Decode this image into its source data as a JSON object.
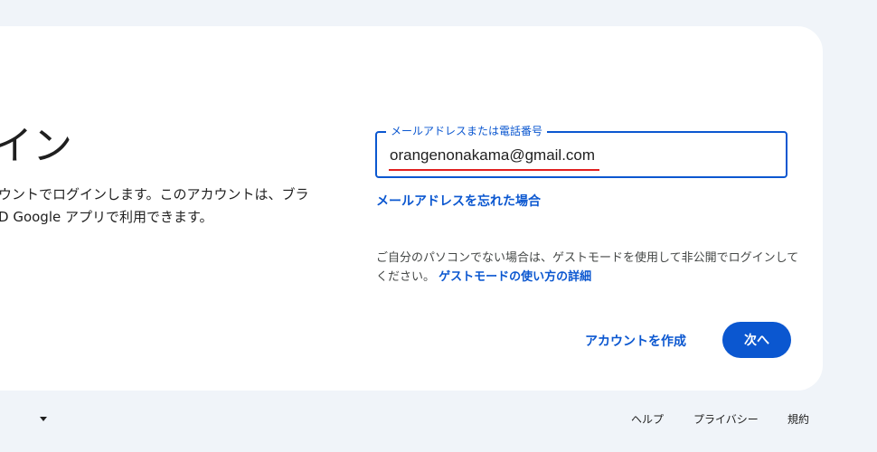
{
  "heading": {
    "title": "イン"
  },
  "description": {
    "line1": "ウントでログインします。このアカウントは、ブラ",
    "line2": "D Google アプリで利用できます。"
  },
  "email_field": {
    "label": "メールアドレスまたは電話番号",
    "value": "orangenonakama@gmail.com"
  },
  "links": {
    "forgot_email": "メールアドレスを忘れた場合",
    "guest_text": "ご自分のパソコンでない場合は、ゲストモードを使用して非公開でログインしてください。",
    "guest_link": "ゲストモードの使い方の詳細",
    "create_account": "アカウントを作成"
  },
  "buttons": {
    "next": "次へ"
  },
  "footer": {
    "help": "ヘルプ",
    "privacy": "プライバシー",
    "terms": "規約"
  },
  "colors": {
    "accent": "#0b57d0",
    "background": "#f0f4f9",
    "card": "#ffffff",
    "spellcheck": "#e02020"
  }
}
